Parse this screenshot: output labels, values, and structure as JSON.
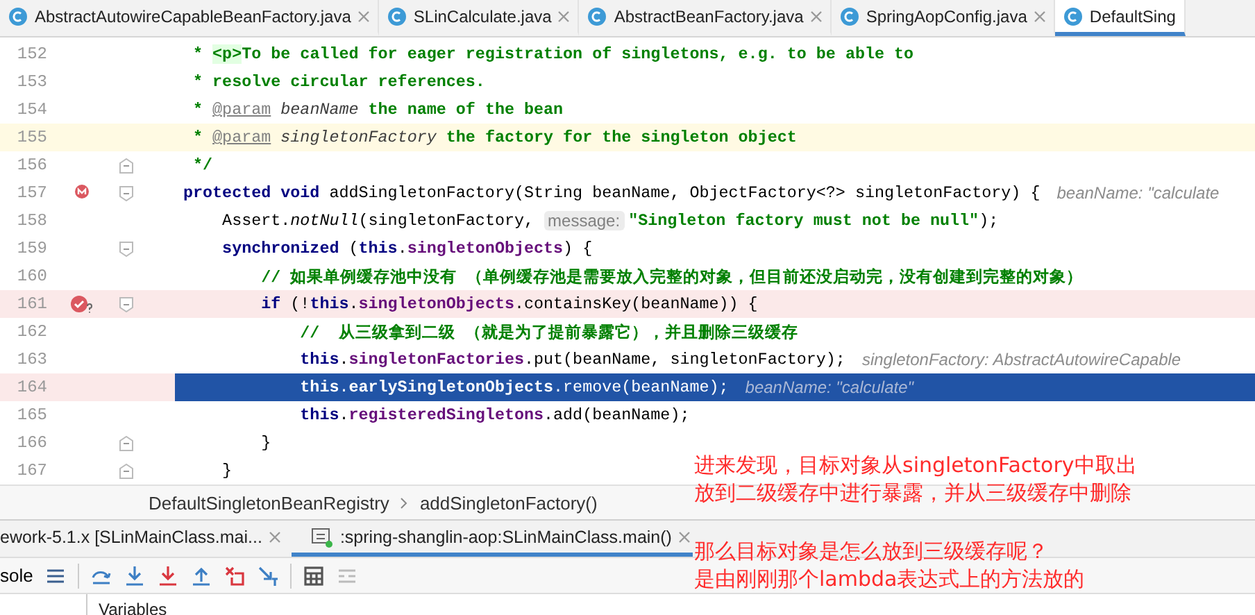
{
  "editor_tabs": [
    {
      "label": "AbstractAutowireCapableBeanFactory.java",
      "closable": true,
      "selected": false
    },
    {
      "label": "SLinCalculate.java",
      "closable": true,
      "selected": false
    },
    {
      "label": "AbstractBeanFactory.java",
      "closable": true,
      "selected": false
    },
    {
      "label": "SpringAopConfig.java",
      "closable": true,
      "selected": false
    },
    {
      "label": "DefaultSing",
      "closable": false,
      "selected": true
    }
  ],
  "code_lines": [
    {
      "number": "152",
      "tokens": [
        {
          "text": " * ",
          "kind": "comment"
        },
        {
          "text": "<p>",
          "kind": "tag"
        },
        {
          "text": "To be called for eager registration of singletons, e.g. to be able to",
          "kind": "comment"
        }
      ]
    },
    {
      "number": "153",
      "tokens": [
        {
          "text": " * resolve circular references.",
          "kind": "comment"
        }
      ]
    },
    {
      "number": "154",
      "tokens": [
        {
          "text": " * ",
          "kind": "comment"
        },
        {
          "text": "@param",
          "kind": "doctag"
        },
        {
          "text": " beanName",
          "kind": "docparam"
        },
        {
          "text": " the name of the bean",
          "kind": "comment"
        }
      ]
    },
    {
      "number": "155",
      "caret_line": true,
      "tokens": [
        {
          "text": " * ",
          "kind": "comment"
        },
        {
          "text": "@param",
          "kind": "doctag"
        },
        {
          "text": " singletonFactory",
          "kind": "docparam"
        },
        {
          "text": " the factory for the singleton object",
          "kind": "comment"
        }
      ]
    },
    {
      "number": "156",
      "fold_end": true,
      "tokens": [
        {
          "text": " */",
          "kind": "comment"
        }
      ]
    },
    {
      "number": "157",
      "fold_start": true,
      "method_breakpoint": true,
      "tokens": [
        {
          "text": "protected void",
          "kind": "keyword"
        },
        {
          "text": " addSingletonFactory(String beanName, ObjectFactory<?> singletonFactory) {",
          "kind": "plain"
        },
        {
          "text": "beanName: \"calculate",
          "kind": "inlay"
        }
      ]
    },
    {
      "number": "158",
      "tokens": [
        {
          "text": "    Assert.",
          "kind": "plain"
        },
        {
          "text": "notNull",
          "kind": "italic"
        },
        {
          "text": "(singletonFactory, ",
          "kind": "plain"
        },
        {
          "text": "message:",
          "kind": "hint"
        },
        {
          "text": "\"Singleton factory must not be null\"",
          "kind": "string"
        },
        {
          "text": ");",
          "kind": "plain"
        }
      ]
    },
    {
      "number": "159",
      "fold_start": true,
      "tokens": [
        {
          "text": "    synchronized",
          "kind": "keyword"
        },
        {
          "text": " (",
          "kind": "plain"
        },
        {
          "text": "this",
          "kind": "keyword"
        },
        {
          "text": ".",
          "kind": "plain"
        },
        {
          "text": "singletonObjects",
          "kind": "field"
        },
        {
          "text": ") {",
          "kind": "plain"
        }
      ]
    },
    {
      "number": "160",
      "tokens": [
        {
          "text": "        // 如果单例缓存池中没有 （单例缓存池是需要放入完整的对象，但目前还没启动完，没有创建到完整的对象）",
          "kind": "comment"
        }
      ]
    },
    {
      "number": "161",
      "fold_start": true,
      "breakpoint": true,
      "tokens": [
        {
          "text": "        if",
          "kind": "keyword"
        },
        {
          "text": " (!",
          "kind": "plain"
        },
        {
          "text": "this",
          "kind": "keyword"
        },
        {
          "text": ".",
          "kind": "plain"
        },
        {
          "text": "singletonObjects",
          "kind": "field"
        },
        {
          "text": ".containsKey(beanName)) {",
          "kind": "plain"
        }
      ]
    },
    {
      "number": "162",
      "tokens": [
        {
          "text": "            //  从三级拿到二级 （就是为了提前暴露它），并且删除三级缓存",
          "kind": "comment"
        }
      ]
    },
    {
      "number": "163",
      "tokens": [
        {
          "text": "            this",
          "kind": "keyword"
        },
        {
          "text": ".",
          "kind": "plain"
        },
        {
          "text": "singletonFactories",
          "kind": "field"
        },
        {
          "text": ".put(beanName, singletonFactory);",
          "kind": "plain"
        },
        {
          "text": "singletonFactory: AbstractAutowireCapable",
          "kind": "inlay"
        }
      ]
    },
    {
      "number": "164",
      "execution_point": true,
      "tokens": [
        {
          "text": "            this",
          "kind": "keyword"
        },
        {
          "text": ".",
          "kind": "plain"
        },
        {
          "text": "earlySingletonObjects",
          "kind": "field"
        },
        {
          "text": ".remove(beanName);",
          "kind": "plain"
        },
        {
          "text": "beanName: \"calculate\"",
          "kind": "inlay"
        }
      ]
    },
    {
      "number": "165",
      "tokens": [
        {
          "text": "            this",
          "kind": "keyword"
        },
        {
          "text": ".",
          "kind": "plain"
        },
        {
          "text": "registeredSingletons",
          "kind": "field"
        },
        {
          "text": ".add(beanName);",
          "kind": "plain"
        }
      ]
    },
    {
      "number": "166",
      "fold_end": true,
      "tokens": [
        {
          "text": "        }",
          "kind": "plain"
        }
      ]
    },
    {
      "number": "167",
      "fold_end": true,
      "tokens": [
        {
          "text": "    }",
          "kind": "plain"
        }
      ]
    }
  ],
  "breadcrumbs": [
    "DefaultSingletonBeanRegistry",
    "addSingletonFactory()"
  ],
  "debug_tabs": [
    {
      "label": "ework-5.1.x [SLinMainClass.mai...",
      "selected": false
    },
    {
      "label": ":spring-shanglin-aop:SLinMainClass.main()",
      "selected": true
    }
  ],
  "debug_toolbar": {
    "console_label": "sole"
  },
  "variables_panel": {
    "title": "Variables"
  },
  "annotations": [
    {
      "lines": [
        "进来发现，目标对象从singletonFactory中取出",
        "放到二级缓存中进行暴露，并从三级缓存中删除"
      ]
    },
    {
      "lines": [
        "那么目标对象是怎么放到三级缓存呢？",
        "是由刚刚那个lambda表达式上的方法放的"
      ]
    }
  ]
}
